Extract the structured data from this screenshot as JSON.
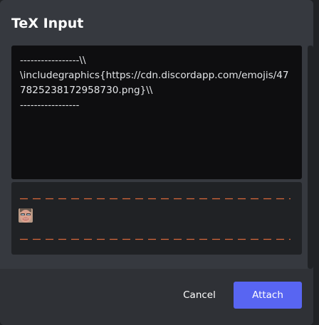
{
  "modal": {
    "title": "TeX Input"
  },
  "editor": {
    "text": "-----------------\\\\\n\\includegraphics{https://cdn.discordapp.com/emojis/477825238172958730.png}\\\\\n-----------------"
  },
  "preview": {
    "dash_color": "#d9693a",
    "emoji_icon": "face-emoji-image"
  },
  "footer": {
    "cancel_label": "Cancel",
    "attach_label": "Attach"
  },
  "colors": {
    "accent": "#5865f2",
    "modal_bg": "#36393f",
    "editor_bg": "#0e0e10",
    "preview_bg": "#202225",
    "footer_bg": "#2f3136"
  }
}
